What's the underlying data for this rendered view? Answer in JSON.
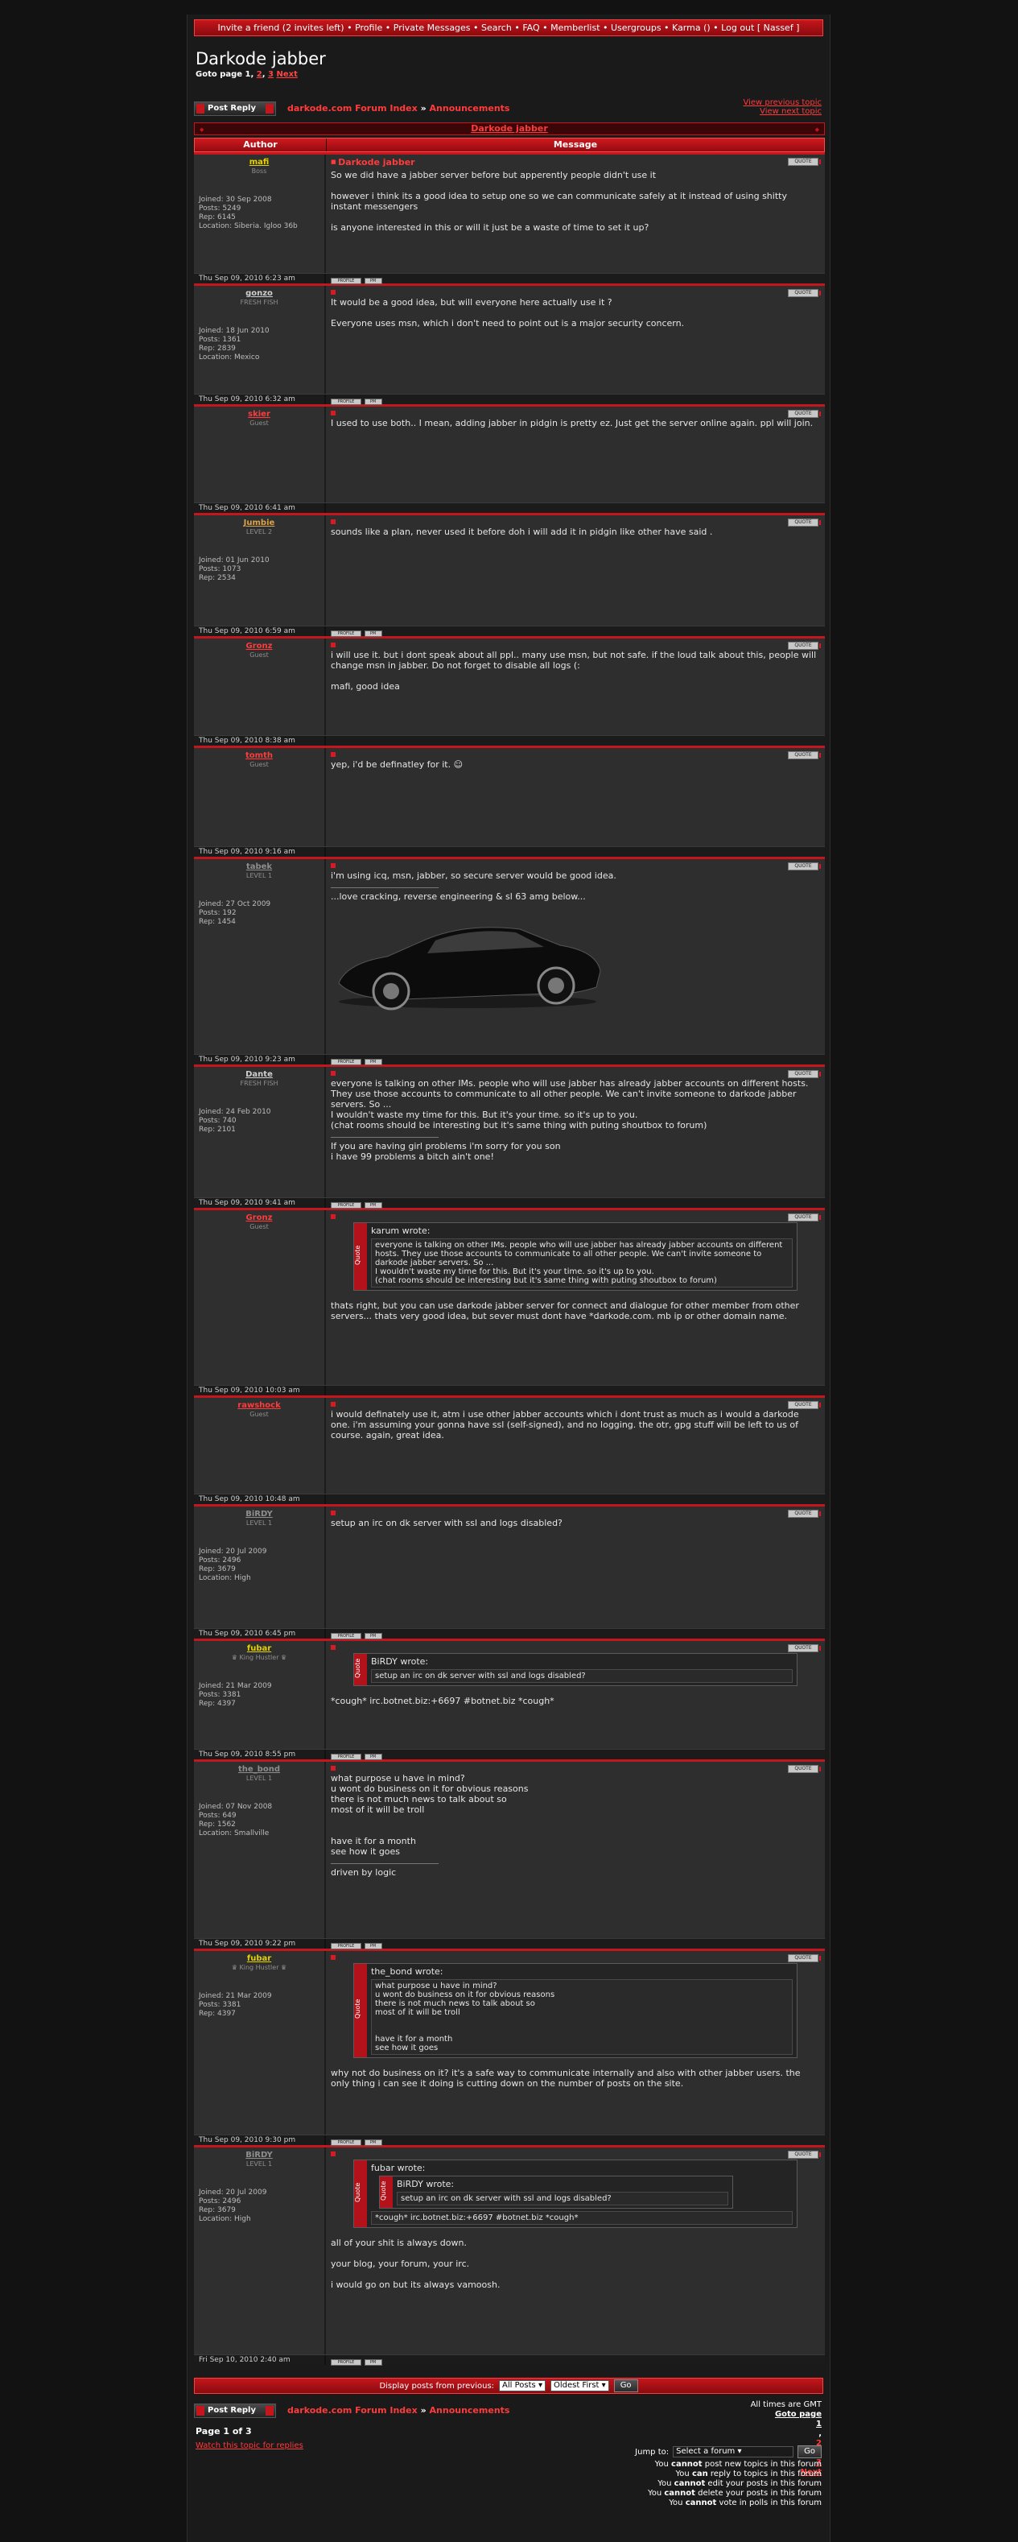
{
  "topbar": {
    "items": [
      "Invite a friend (2 invites left)",
      "Profile",
      "Private Messages",
      "Search",
      "FAQ",
      "Memberlist",
      "Usergroups",
      "Karma ()",
      "Log out [ Nassef ]"
    ]
  },
  "thread": {
    "title": "Darkode jabber",
    "goto_label": "Goto page",
    "pages": [
      "1",
      "2",
      "3"
    ],
    "next_label": "Next"
  },
  "nav": {
    "post_reply_label": "Post Reply",
    "forum_index": "darkode.com Forum Index",
    "separator": "»",
    "section": "Announcements",
    "view_previous": "View previous topic",
    "view_next": "View next topic"
  },
  "table": {
    "title": "Darkode jabber",
    "col_author": "Author",
    "col_message": "Message"
  },
  "colors": {
    "accent": "#c4161c",
    "link_red": "#ff3b3b",
    "admin_gold": "#e5d000"
  },
  "posts": [
    {
      "author": "mafi",
      "color": "#e5d000",
      "rank": "Boss",
      "joined": "Joined: 30 Sep 2008",
      "posts": "Posts: 5249",
      "rep": "Rep: 6145",
      "location": "Location: Siberia. Igloo 36b",
      "time": "Thu Sep 09, 2010 6:23 am",
      "subject": "Darkode jabber",
      "message": "So we did have a jabber server before but apperently people didn't use it\n\nhowever i think its a good idea to setup one so we can communicate safely at it instead of using shitty instant messengers\n\nis anyone interested in this or will it just be a waste of time to set it up?"
    },
    {
      "author": "gonzo",
      "color": "#cfcfcf",
      "rank": "FRESH FISH",
      "joined": "Joined: 18 Jun 2010",
      "posts": "Posts: 1361",
      "rep": "Rep: 2839",
      "location": "Location: Mexico",
      "time": "Thu Sep 09, 2010 6:32 am",
      "message": "It would be a good idea, but will everyone here actually use it ?\n\nEveryone uses msn, which i don't need to point out is a major security concern."
    },
    {
      "author": "skier",
      "color": "#ff3b3b",
      "rank": "Guest",
      "time": "Thu Sep 09, 2010 6:41 am",
      "message": "I used to use both.. I mean, adding jabber in pidgin is pretty ez. Just get the server online again. ppl will join."
    },
    {
      "author": "Jumbie",
      "color": "#d9a34a",
      "rank": "LEVEL 2",
      "joined": "Joined: 01 Jun 2010",
      "posts": "Posts: 1073",
      "rep": "Rep: 2534",
      "time": "Thu Sep 09, 2010 6:59 am",
      "message": "sounds like a plan, never used it before doh i will add it in pidgin like other have said ."
    },
    {
      "author": "Gronz",
      "color": "#ff3b3b",
      "rank": "Guest",
      "time": "Thu Sep 09, 2010 8:38 am",
      "message": "i will use it. but i dont speak about all ppl.. many use msn, but not safe. if the loud talk about this, people will change msn in jabber. Do not forget to disable all logs (:\n\nmafi, good idea"
    },
    {
      "author": "tomth",
      "color": "#ff3b3b",
      "rank": "Guest",
      "time": "Thu Sep 09, 2010 9:16 am",
      "message": "yep, i'd be definatley for it. ☺"
    },
    {
      "author": "tabek",
      "color": "#8e8e8e",
      "rank": "LEVEL 1",
      "joined": "Joined: 27 Oct 2009",
      "posts": "Posts: 192",
      "rep": "Rep: 1454",
      "time": "Thu Sep 09, 2010 9:23 am",
      "message": "i'm using icq, msn, jabber, so secure server would be good idea.",
      "signature": "...love cracking, reverse engineering & sl 63 amg below..."
    },
    {
      "author": "Dante",
      "color": "#cfcfcf",
      "rank": "FRESH FISH",
      "joined": "Joined: 24 Feb 2010",
      "posts": "Posts: 740",
      "rep": "Rep: 2101",
      "time": "Thu Sep 09, 2010 9:41 am",
      "message": "everyone is talking on other IMs. people who will use jabber has already jabber accounts on different hosts. They use those accounts to communicate to all other people. We can't invite someone to darkode jabber servers. So ...\nI wouldn't waste my time for this. But it's your time. so it's up to you.\n(chat rooms should be interesting but it's same thing with puting shoutbox to forum)",
      "signature": "If you are having girl problems i'm sorry for you son\ni have 99 problems a bitch ain't one!"
    },
    {
      "author": "Gronz",
      "color": "#ff3b3b",
      "rank": "Guest",
      "time": "Thu Sep 09, 2010 10:03 am",
      "quote_who": "karum wrote:",
      "quote": "everyone is talking on other IMs. people who will use jabber has already jabber accounts on different hosts. They use those accounts to communicate to all other people. We can't invite someone to darkode jabber servers. So ...\nI wouldn't waste my time for this. But it's your time. so it's up to you.\n(chat rooms should be interesting but it's same thing with puting shoutbox to forum)",
      "message": "thats right, but you can use darkode jabber server for connect and dialogue for other member from other servers... thats very good idea, but sever must dont have *darkode.com. mb ip or other domain name."
    },
    {
      "author": "rawshock",
      "color": "#ff3b3b",
      "rank": "Guest",
      "time": "Thu Sep 09, 2010 10:48 am",
      "message": "i would definately use it, atm i use other jabber accounts which i dont trust as much as i would a darkode one. i'm assuming your gonna have ssl (self-signed), and no logging. the otr, gpg stuff will be left to us of course. again, great idea."
    },
    {
      "author": "BiRDY",
      "color": "#8e8e8e",
      "rank": "LEVEL 1",
      "joined": "Joined: 20 Jul 2009",
      "posts": "Posts: 2496",
      "rep": "Rep: 3679",
      "location": "Location: High",
      "time": "Thu Sep 09, 2010 6:45 pm",
      "message": "setup an irc on dk server with ssl and logs disabled?"
    },
    {
      "author": "fubar",
      "color": "#e5d000",
      "rank": "♛ King Hustler ♛",
      "joined": "Joined: 21 Mar 2009",
      "posts": "Posts: 3381",
      "rep": "Rep: 4397",
      "time": "Thu Sep 09, 2010 8:55 pm",
      "quote_who": "BiRDY wrote:",
      "quote": "setup an irc on dk server with ssl and logs disabled?",
      "message": "*cough* irc.botnet.biz:+6697 #botnet.biz *cough*"
    },
    {
      "author": "the_bond",
      "color": "#8e8e8e",
      "rank": "LEVEL 1",
      "joined": "Joined: 07 Nov 2008",
      "posts": "Posts: 649",
      "rep": "Rep: 1562",
      "location": "Location: Smallville",
      "time": "Thu Sep 09, 2010 9:22 pm",
      "message": "what purpose u have in mind?\nu wont do business on it for obvious reasons\nthere is not much news to talk about so\nmost of it will be troll\n\n\nhave it for a month\nsee how it goes",
      "signature": "driven by logic"
    },
    {
      "author": "fubar",
      "color": "#e5d000",
      "rank": "♛ King Hustler ♛",
      "joined": "Joined: 21 Mar 2009",
      "posts": "Posts: 3381",
      "rep": "Rep: 4397",
      "time": "Thu Sep 09, 2010 9:30 pm",
      "quote_who": "the_bond wrote:",
      "quote": "what purpose u have in mind?\nu wont do business on it for obvious reasons\nthere is not much news to talk about so\nmost of it will be troll\n\n\nhave it for a month\nsee how it goes",
      "message": "why not do business on it? it's a safe way to communicate internally and also with other jabber users. the only thing i can see it doing is cutting down on the number of posts on the site."
    },
    {
      "author": "BiRDY",
      "color": "#8e8e8e",
      "rank": "LEVEL 1",
      "joined": "Joined: 20 Jul 2009",
      "posts": "Posts: 2496",
      "rep": "Rep: 3679",
      "location": "Location: High",
      "time": "Fri Sep 10, 2010 2:40 am",
      "quote_who": "fubar wrote:",
      "nested_who": "BiRDY wrote:",
      "nested": "setup an irc on dk server with ssl and logs disabled?",
      "quote": "*cough* irc.botnet.biz:+6697 #botnet.biz *cough*",
      "message": "all of your shit is always down.\n\nyour blog, your forum, your irc.\n\ni would go on but its always vamoosh."
    }
  ],
  "display_bar": {
    "label": "Display posts from previous:",
    "period": "All Posts",
    "order": "Oldest First",
    "go_label": "Go"
  },
  "footer": {
    "timezone": "All times are GMT",
    "page_of": "Page 1 of 3",
    "watch": "Watch this topic for replies",
    "jump_label": "Jump to:",
    "jump_select": "Select a forum",
    "go_label": "Go",
    "permissions": [
      [
        "You ",
        "cannot",
        " post new topics in this forum"
      ],
      [
        "You ",
        "can",
        " reply to topics in this forum"
      ],
      [
        "You ",
        "cannot",
        " edit your posts in this forum"
      ],
      [
        "You ",
        "cannot",
        " delete your posts in this forum"
      ],
      [
        "You ",
        "cannot",
        " vote in polls in this forum"
      ]
    ]
  }
}
